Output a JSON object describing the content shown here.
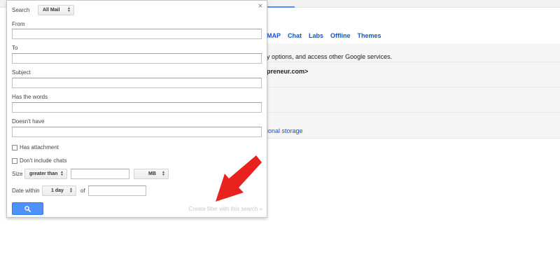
{
  "background": {
    "tabs": [
      "MAP",
      "Chat",
      "Labs",
      "Offline",
      "Themes"
    ],
    "line1": "y options, and access other Google services.",
    "line2": "preneur.com>",
    "line3": "ional storage"
  },
  "popup": {
    "close_glyph": "×",
    "search_label": "Search",
    "search_scope": "All Mail",
    "from_label": "From",
    "to_label": "To",
    "subject_label": "Subject",
    "has_words_label": "Has the words",
    "doesnt_have_label": "Doesn't have",
    "has_attachment_label": "Has attachment",
    "dont_include_chats_label": "Don't include chats",
    "size_label": "Size",
    "size_operator": "greater than",
    "size_unit": "MB",
    "date_within_label": "Date within",
    "date_within_value": "1 day",
    "of_label": "of",
    "create_filter_label": "Create filter with this search »"
  },
  "colors": {
    "primary_button": "#4d90fe",
    "link": "#1155cc",
    "annotation_arrow": "#e8231f"
  }
}
